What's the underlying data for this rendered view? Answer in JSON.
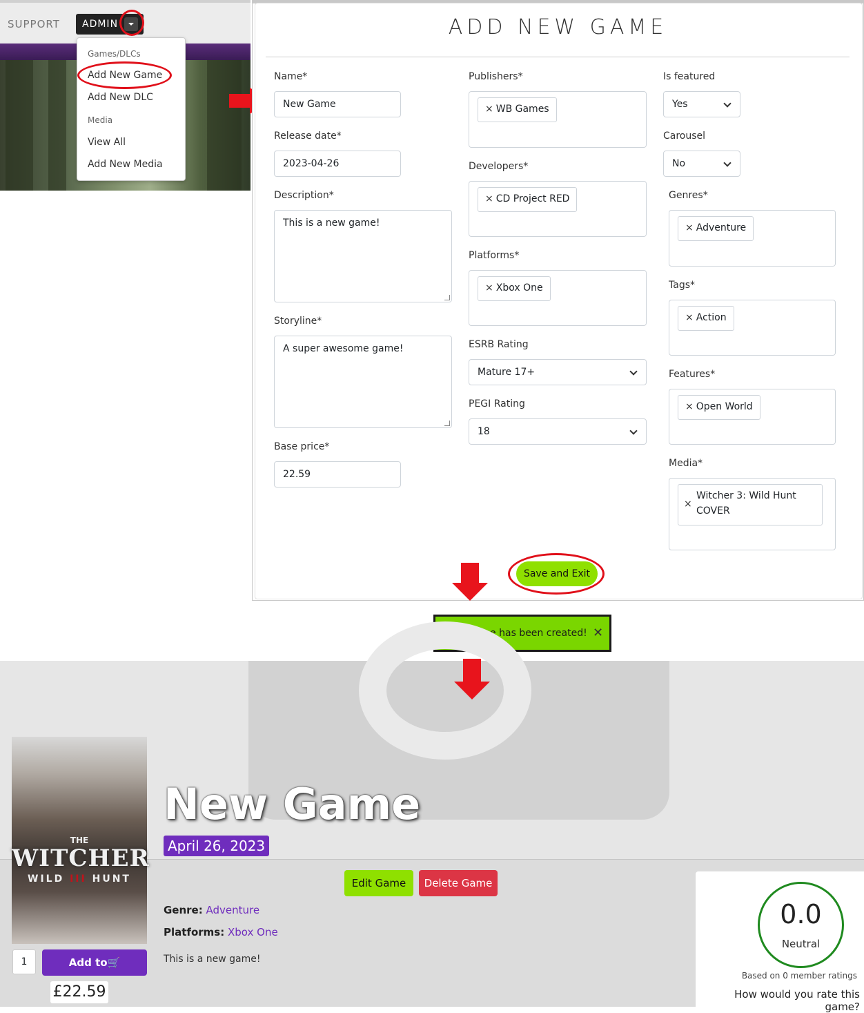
{
  "nav": {
    "support": "SUPPORT",
    "admin": "ADMIN",
    "dropdown": {
      "section_games": "Games/DLCs",
      "add_new_game": "Add New Game",
      "add_new_dlc": "Add New DLC",
      "section_media": "Media",
      "view_all": "View All",
      "add_new_media": "Add New Media"
    }
  },
  "form": {
    "title": "ADD NEW GAME",
    "name_label": "Name*",
    "name_value": "New Game",
    "release_label": "Release date*",
    "release_value": "2023-04-26",
    "description_label": "Description*",
    "description_value": "This is a new game!",
    "storyline_label": "Storyline*",
    "storyline_value": "A super awesome game!",
    "base_price_label": "Base price*",
    "base_price_value": "22.59",
    "publishers_label": "Publishers*",
    "publishers_chip": "WB Games",
    "developers_label": "Developers*",
    "developers_chip": "CD Project RED",
    "platforms_label": "Platforms*",
    "platforms_chip": "Xbox One",
    "esrb_label": "ESRB Rating",
    "esrb_value": "Mature 17+",
    "pegi_label": "PEGI Rating",
    "pegi_value": "18",
    "featured_label": "Is featured",
    "featured_value": "Yes",
    "carousel_label": "Carousel",
    "carousel_value": "No",
    "genres_label": "Genres*",
    "genres_chip": "Adventure",
    "tags_label": "Tags*",
    "tags_chip": "Action",
    "features_label": "Features*",
    "features_chip": "Open World",
    "media_label": "Media*",
    "media_chip_line1": "Witcher 3: Wild Hunt",
    "media_chip_line2": "COVER",
    "save_button": "Save and Exit",
    "chip_remove_icon": "×"
  },
  "toast": {
    "message": "New Game has been created!",
    "close": "✕"
  },
  "product": {
    "title": "New Game",
    "release_date": "April 26, 2023",
    "edit_button": "Edit Game",
    "delete_button": "Delete Game",
    "genre_label": "Genre:",
    "genre_value": "Adventure",
    "platforms_label": "Platforms:",
    "platforms_value": "Xbox One",
    "description": "This is a new game!",
    "quantity": "1",
    "add_to_cart": "Add to",
    "cart_icon": "🛒",
    "price": "£22.59",
    "cover": {
      "the": "THE",
      "witcher": "WITCHER",
      "wild": "WILD",
      "iii": "III",
      "hunt": "HUNT"
    }
  },
  "rating": {
    "score": "0.0",
    "label": "Neutral",
    "based_on": "Based on 0 member ratings",
    "question": "How would you rate this game?"
  },
  "colors": {
    "accent_purple": "#6f2dbd",
    "save_green": "#8fe000",
    "toast_green": "#7ad600",
    "delete_red": "#dc3545",
    "annotation_red": "#e0101a",
    "rating_ring": "#1f8a1f"
  }
}
